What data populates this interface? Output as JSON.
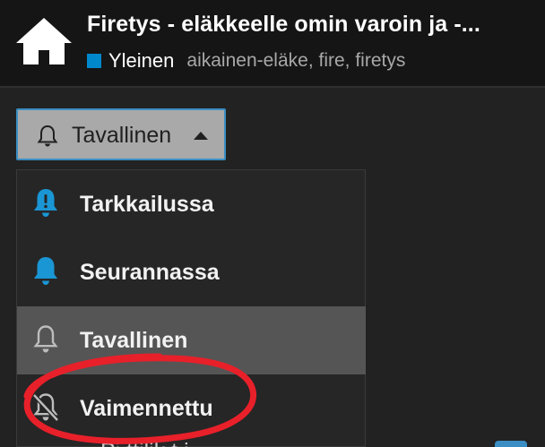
{
  "header": {
    "title": "Firetys - eläkkeelle omin varoin ja -...",
    "category": {
      "name": "Yleinen",
      "color": "#0088cc"
    },
    "tags": "aikainen-eläke, fire, firetys",
    "home_icon": "home-icon"
  },
  "notification_dropdown": {
    "current_label": "Tavallinen",
    "icon": "bell-outline-icon",
    "caret_icon": "caret-up-icon",
    "items": [
      {
        "label": "Tarkkailussa",
        "icon": "bell-exclamation-icon",
        "icon_color": "#1a96d4",
        "selected": false
      },
      {
        "label": "Seurannassa",
        "icon": "bell-filled-icon",
        "icon_color": "#1a96d4",
        "selected": false
      },
      {
        "label": "Tavallinen",
        "icon": "bell-outline-icon",
        "icon_color": "#bdbdbd",
        "selected": true
      },
      {
        "label": "Vaimennettu",
        "icon": "bell-slash-icon",
        "icon_color": "#bdbdbd",
        "selected": false
      }
    ]
  },
  "below_content": {
    "partial_text": "Pi           ttilik   t i"
  },
  "annotation": {
    "color": "#e8202a",
    "shape": "hand-drawn-circle"
  }
}
